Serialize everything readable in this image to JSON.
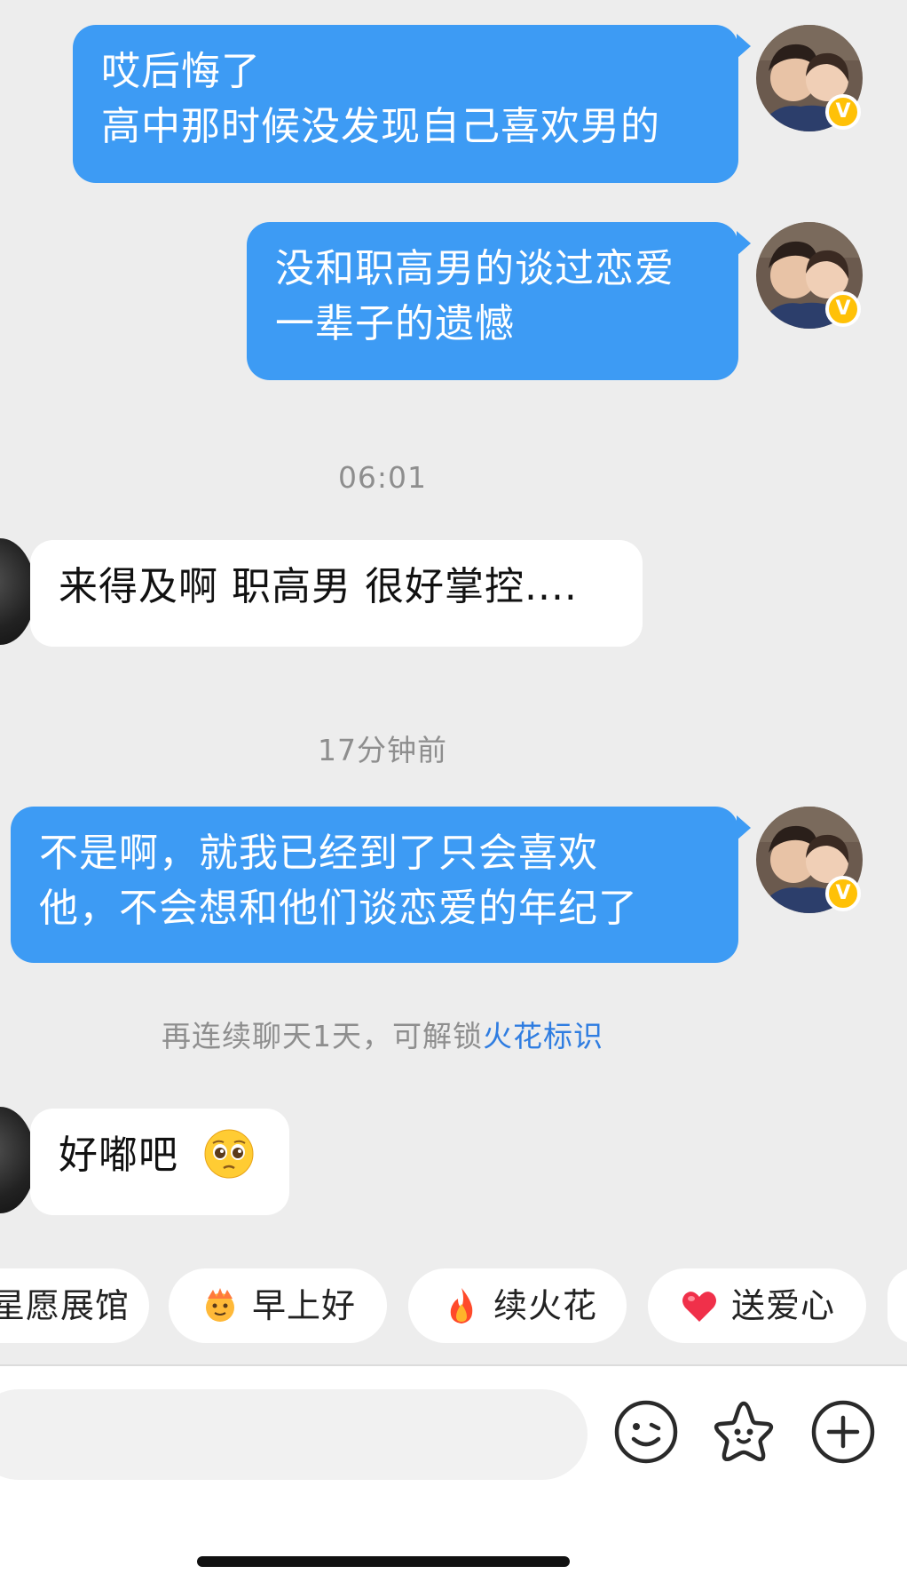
{
  "messages": [
    {
      "side": "me",
      "lines": [
        "哎后悔了",
        "高中那时候没发现自己喜欢男的"
      ]
    },
    {
      "side": "me",
      "lines": [
        "没和职高男的谈过恋爱",
        "一辈子的遗憾"
      ]
    },
    {
      "timestamp": "06:01"
    },
    {
      "side": "other",
      "lines": [
        "来得及啊  职高男 很好掌控...."
      ]
    },
    {
      "timestamp": "17分钟前"
    },
    {
      "side": "me",
      "lines": [
        "不是啊，就我已经到了只会喜欢",
        "他，不会想和他们谈恋爱的年纪了"
      ]
    },
    {
      "side": "other",
      "lines": [
        "好嘟吧"
      ],
      "emoji": "pleading-face"
    }
  ],
  "hint": {
    "prefix": "再连续聊天1天，可解锁",
    "link": "火花标识"
  },
  "badge_letter": "V",
  "quick_replies": [
    {
      "label": "星愿展馆",
      "emoji": ""
    },
    {
      "label": "早上好",
      "emoji": "sun-face"
    },
    {
      "label": "续火花",
      "emoji": "fire"
    },
    {
      "label": "送爱心",
      "emoji": "heart"
    }
  ],
  "toolbar": {
    "icons": [
      "emoji-smile-icon",
      "sticker-star-icon",
      "add-plus-icon"
    ]
  },
  "colors": {
    "my_bubble": "#3d9bf4",
    "other_bubble": "#ffffff",
    "background": "#ededed",
    "link": "#2f7de1",
    "badge": "#ffc107"
  }
}
